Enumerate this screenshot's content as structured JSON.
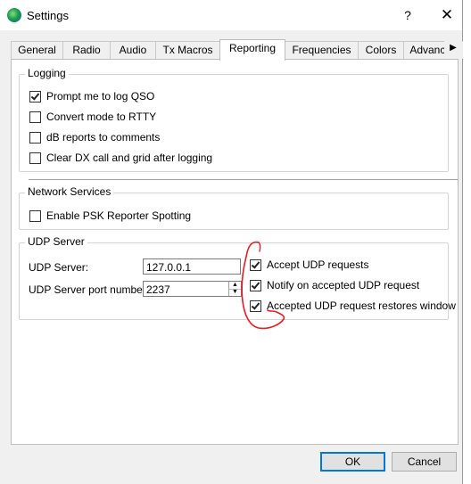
{
  "window": {
    "title": "Settings",
    "help": "?",
    "close": "✕"
  },
  "tabs": [
    "General",
    "Radio",
    "Audio",
    "Tx Macros",
    "Reporting",
    "Frequencies",
    "Colors",
    "Advanced"
  ],
  "active_tab": "Reporting",
  "logging": {
    "title": "Logging",
    "options": [
      {
        "label": "Prompt me to log QSO",
        "checked": true
      },
      {
        "label": "Convert mode to RTTY",
        "checked": false
      },
      {
        "label": "dB reports to comments",
        "checked": false
      },
      {
        "label": "Clear DX call and grid after logging",
        "checked": false
      }
    ]
  },
  "network": {
    "title": "Network Services",
    "options": [
      {
        "label": "Enable PSK Reporter Spotting",
        "checked": false
      }
    ]
  },
  "udp": {
    "title": "UDP Server",
    "server_label": "UDP Server:",
    "server_value": "127.0.0.1",
    "port_label": "UDP Server port number:",
    "port_value": "2237",
    "options": [
      {
        "label": "Accept UDP requests",
        "checked": true
      },
      {
        "label": "Notify on accepted UDP request",
        "checked": true
      },
      {
        "label": "Accepted UDP request restores window",
        "checked": true
      }
    ]
  },
  "buttons": {
    "ok": "OK",
    "cancel": "Cancel"
  },
  "colors": {
    "annotation": "#e0202a",
    "accent": "#0078d7"
  }
}
